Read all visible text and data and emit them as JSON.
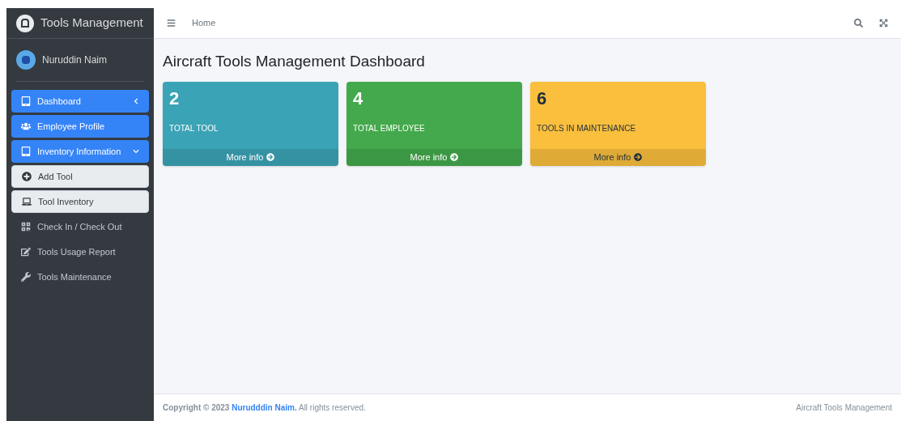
{
  "brand": {
    "title": "Tools Management"
  },
  "user": {
    "name": "Nuruddin Naim"
  },
  "nav": [
    {
      "label": "Dashboard",
      "highlighted": true,
      "expanded": false
    },
    {
      "label": "Employee Profile",
      "highlighted": true
    },
    {
      "label": "Inventory Information",
      "highlighted": true,
      "expanded": true,
      "children": [
        {
          "label": "Add Tool"
        },
        {
          "label": "Tool Inventory"
        }
      ]
    },
    {
      "label": "Check In / Check Out",
      "highlighted": false
    },
    {
      "label": "Tools Usage Report",
      "highlighted": false
    },
    {
      "label": "Tools Maintenance",
      "highlighted": false
    }
  ],
  "topbar": {
    "breadcrumb": "Home"
  },
  "page_title": "Aircraft Tools Management Dashboard",
  "cards": [
    {
      "value": "2",
      "label": "TOTAL TOOL",
      "link": "More info",
      "color": "#3ba3b6"
    },
    {
      "value": "4",
      "label": "TOTAL EMPLOYEE",
      "link": "More info",
      "color": "#43a94c"
    },
    {
      "value": "6",
      "label": "TOOLS IN MAINTENANCE",
      "link": "More info",
      "color": "#f9bf3d"
    }
  ],
  "footer": {
    "copyright": "**Copyright © 2023**",
    "author": "Nurudddin Naim.",
    "rights": "All rights reserved.",
    "app_name": "Aircraft Tools Management"
  }
}
